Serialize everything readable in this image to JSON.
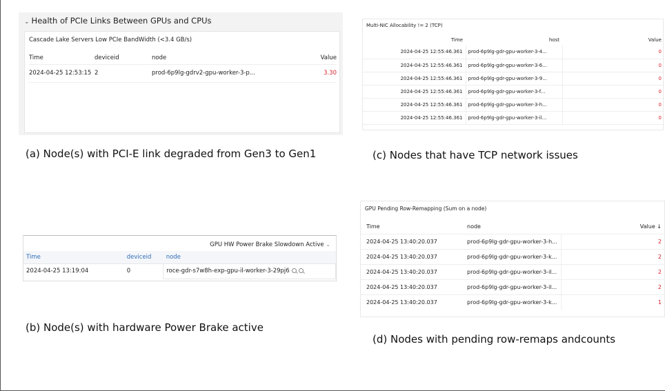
{
  "panel_a": {
    "section_title": "Health of PCIe Links Between GPUs and CPUs",
    "panel_title": "Cascade Lake Servers Low PCIe BandWidth (<3.4 GB/s)",
    "columns": [
      "Time",
      "deviceid",
      "node",
      "Value"
    ],
    "rows": [
      {
        "time": "2024-04-25 12:53:15",
        "deviceid": "2",
        "node": "prod-6p9lg-gdrv2-gpu-worker-3-p...",
        "value": "3.30"
      }
    ],
    "caption": "(a) Node(s) with PCI-E link degraded from Gen3 to Gen1"
  },
  "panel_c": {
    "panel_title": "Multi-NIC Allocability != 2 (TCP)",
    "columns": [
      "Time",
      "host",
      "Value"
    ],
    "rows": [
      {
        "time": "2024-04-25 12:55:46.361",
        "host": "prod-6p9lg-gdr-gpu-worker-3-4...",
        "value": "0"
      },
      {
        "time": "2024-04-25 12:55:46.361",
        "host": "prod-6p9lg-gdr-gpu-worker-3-6...",
        "value": "0"
      },
      {
        "time": "2024-04-25 12:55:46.361",
        "host": "prod-6p9lg-gdr-gpu-worker-3-9...",
        "value": "0"
      },
      {
        "time": "2024-04-25 12:55:46.361",
        "host": "prod-6p9lg-gdr-gpu-worker-3-f...",
        "value": "0"
      },
      {
        "time": "2024-04-25 12:55:46.361",
        "host": "prod-6p9lg-gdr-gpu-worker-3-h...",
        "value": "0"
      },
      {
        "time": "2024-04-25 12:55:46.361",
        "host": "prod-6p9lg-gdr-gpu-worker-3-il...",
        "value": "0"
      }
    ],
    "caption": "(c) Nodes that have TCP network issues"
  },
  "panel_b": {
    "panel_title": "GPU HW Power Brake Slowdown Active",
    "columns": [
      "Time",
      "deviceid",
      "node"
    ],
    "rows": [
      {
        "time": "2024-04-25 13:19:04",
        "deviceid": "0",
        "node": "roce-gdr-s7w8h-exp-gpu-il-worker-3-29pj6"
      }
    ],
    "caption": "(b) Node(s) with hardware Power Brake active"
  },
  "panel_d": {
    "panel_title": "GPU Pending Row-Remapping (Sum on a node)",
    "columns": [
      "Time",
      "node",
      "Value"
    ],
    "rows": [
      {
        "time": "2024-04-25 13:40:20.037",
        "node": "prod-6p9lg-gdr-gpu-worker-3-h...",
        "value": "2"
      },
      {
        "time": "2024-04-25 13:40:20.037",
        "node": "prod-6p9lg-gdr-gpu-worker-3-k...",
        "value": "2"
      },
      {
        "time": "2024-04-25 13:40:20.037",
        "node": "prod-6p9lg-gdr-gpu-worker-3-il...",
        "value": "2"
      },
      {
        "time": "2024-04-25 13:40:20.037",
        "node": "prod-6p9lg-gdr-gpu-worker-3-il...",
        "value": "2"
      },
      {
        "time": "2024-04-25 13:40:20.037",
        "node": "prod-6p9lg-gdr-gpu-worker-3-k...",
        "value": "1"
      }
    ],
    "caption": "(d) Nodes with pending row-remaps andcounts"
  },
  "colors": {
    "alert_value": "#d9202a",
    "link_header": "#2f6db5"
  }
}
